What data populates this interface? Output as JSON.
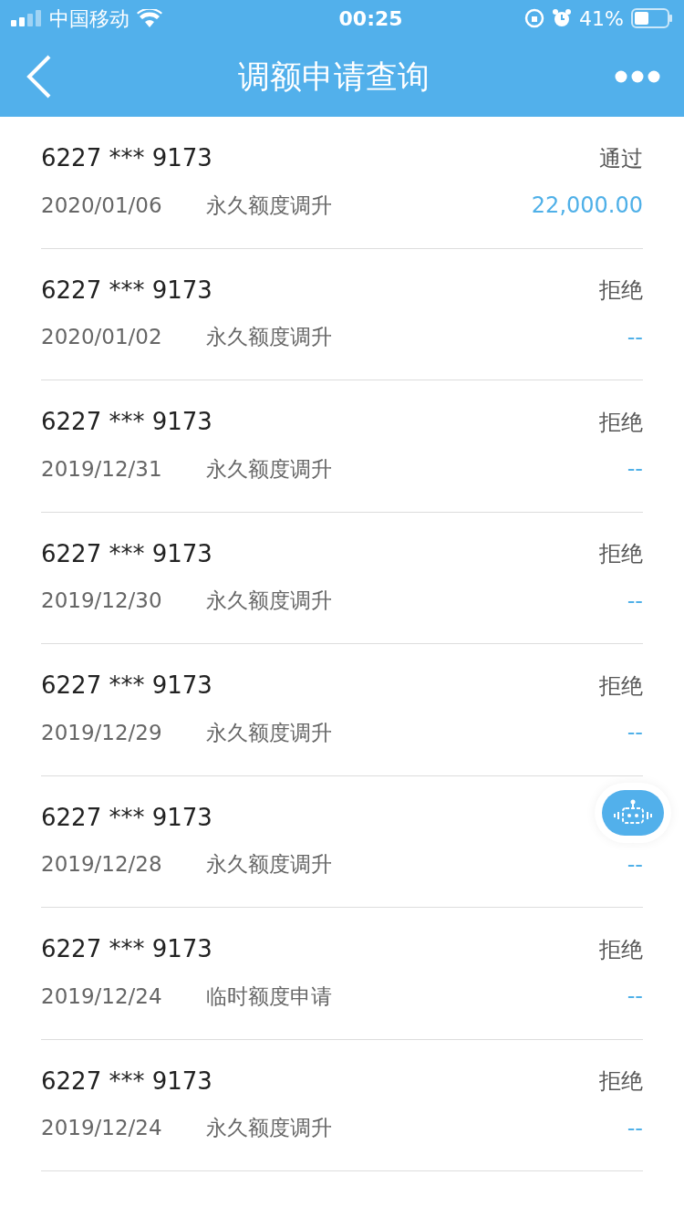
{
  "status_bar": {
    "carrier": "中国移动",
    "time": "00:25",
    "battery": "41%"
  },
  "nav": {
    "title": "调额申请查询"
  },
  "records": [
    {
      "account": "6227 *** 9173",
      "status": "通过",
      "date": "2020/01/06",
      "type": "永久额度调升",
      "amount": "22,000.00"
    },
    {
      "account": "6227 *** 9173",
      "status": "拒绝",
      "date": "2020/01/02",
      "type": "永久额度调升",
      "amount": "--"
    },
    {
      "account": "6227 *** 9173",
      "status": "拒绝",
      "date": "2019/12/31",
      "type": "永久额度调升",
      "amount": "--"
    },
    {
      "account": "6227 *** 9173",
      "status": "拒绝",
      "date": "2019/12/30",
      "type": "永久额度调升",
      "amount": "--"
    },
    {
      "account": "6227 *** 9173",
      "status": "拒绝",
      "date": "2019/12/29",
      "type": "永久额度调升",
      "amount": "--"
    },
    {
      "account": "6227 *** 9173",
      "date": "2019/12/28",
      "type": "永久额度调升",
      "amount": "--"
    },
    {
      "account": "6227 *** 9173",
      "status": "拒绝",
      "date": "2019/12/24",
      "type": "临时额度申请",
      "amount": "--"
    },
    {
      "account": "6227 *** 9173",
      "status": "拒绝",
      "date": "2019/12/24",
      "type": "永久额度调升",
      "amount": "--"
    }
  ]
}
